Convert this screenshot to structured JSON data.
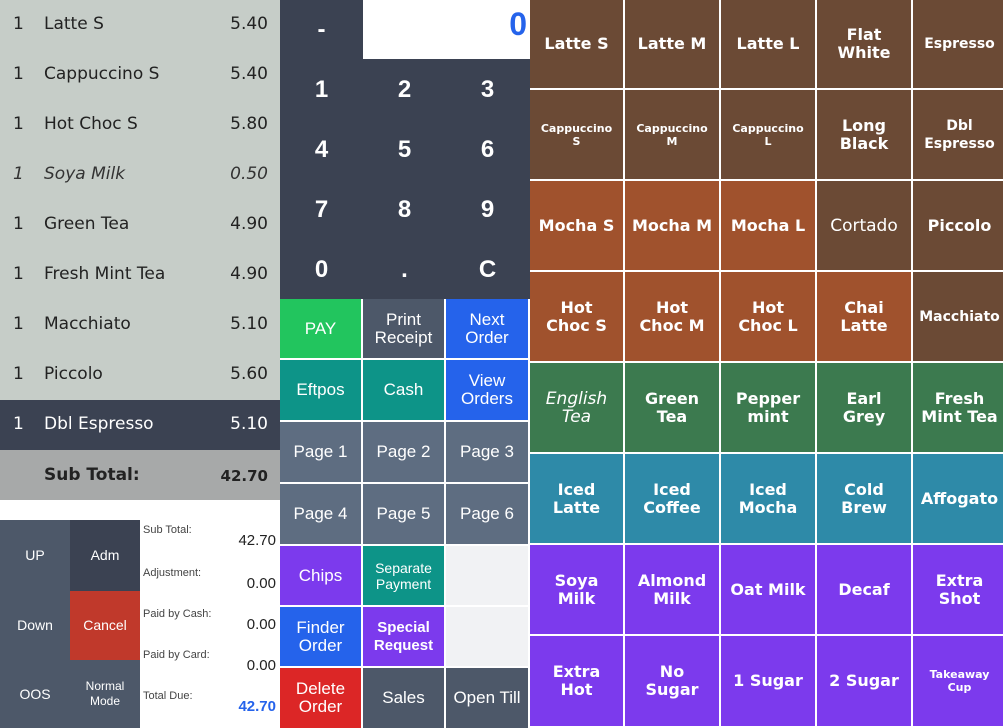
{
  "order": {
    "lines": [
      {
        "qty": "1",
        "name": "Latte S",
        "price": "5.40",
        "kind": "item"
      },
      {
        "qty": "1",
        "name": "Cappuccino S",
        "price": "5.40",
        "kind": "item"
      },
      {
        "qty": "1",
        "name": "Hot Choc S",
        "price": "5.80",
        "kind": "item"
      },
      {
        "qty": "1",
        "name": "Soya Milk",
        "price": "0.50",
        "kind": "modifier"
      },
      {
        "qty": "1",
        "name": "Green Tea",
        "price": "4.90",
        "kind": "item"
      },
      {
        "qty": "1",
        "name": "Fresh Mint Tea",
        "price": "4.90",
        "kind": "item"
      },
      {
        "qty": "1",
        "name": "Macchiato",
        "price": "5.10",
        "kind": "item"
      },
      {
        "qty": "1",
        "name": "Piccolo",
        "price": "5.60",
        "kind": "item"
      },
      {
        "qty": "1",
        "name": "Dbl Espresso",
        "price": "5.10",
        "kind": "selected"
      }
    ],
    "subtotal_label": "Sub Total:",
    "subtotal_value": "42.70"
  },
  "functions": {
    "up": "UP",
    "adm": "Adm",
    "down": "Down",
    "cancel": "Cancel",
    "oos": "OOS",
    "normal_mode": "Normal Mode"
  },
  "totals": [
    {
      "label": "Sub Total:",
      "value": "42.70"
    },
    {
      "label": "Adjustment:",
      "value": "0.00"
    },
    {
      "label": "Paid by Cash:",
      "value": "0.00"
    },
    {
      "label": "Paid by Card:",
      "value": "0.00"
    },
    {
      "label": "Total Due:",
      "value": "42.70"
    }
  ],
  "keypad": {
    "display": "0",
    "minus": "-",
    "keys": [
      "1",
      "2",
      "3",
      "4",
      "5",
      "6",
      "7",
      "8",
      "9",
      "0",
      ".",
      "C"
    ]
  },
  "actions": {
    "pay": "PAY",
    "print_receipt": "Print Receipt",
    "next_order": "Next Order",
    "eftpos": "Eftpos",
    "cash": "Cash",
    "view_orders": "View Orders",
    "page1": "Page 1",
    "page2": "Page 2",
    "page3": "Page 3",
    "page4": "Page 4",
    "page5": "Page 5",
    "page6": "Page 6",
    "chips": "Chips",
    "separate_payment": "Separate Payment",
    "finder_order": "Finder Order",
    "special_request": "Special Request",
    "delete_order": "Delete Order",
    "sales": "Sales",
    "open_till": "Open Till"
  },
  "products": [
    {
      "label": "Latte S",
      "color": "#6b4a35",
      "style": "bold"
    },
    {
      "label": "Latte M",
      "color": "#6b4a35",
      "style": "bold"
    },
    {
      "label": "Latte L",
      "color": "#6b4a35",
      "style": "bold"
    },
    {
      "label": "Flat\nWhite",
      "color": "#6b4a35",
      "style": "bold"
    },
    {
      "label": "Espresso",
      "color": "#6b4a35",
      "style": "bold-sm"
    },
    {
      "label": "Cappuccino\nS",
      "color": "#6b4a35",
      "style": "small"
    },
    {
      "label": "Cappuccino\nM",
      "color": "#6b4a35",
      "style": "small"
    },
    {
      "label": "Cappuccino\nL",
      "color": "#6b4a35",
      "style": "small"
    },
    {
      "label": "Long\nBlack",
      "color": "#6b4a35",
      "style": "bold"
    },
    {
      "label": "Dbl\nEspresso",
      "color": "#6b4a35",
      "style": "bold-sm"
    },
    {
      "label": "Mocha S",
      "color": "#a0522d",
      "style": "bold"
    },
    {
      "label": "Mocha M",
      "color": "#a0522d",
      "style": "bold"
    },
    {
      "label": "Mocha L",
      "color": "#a0522d",
      "style": "bold"
    },
    {
      "label": "Cortado",
      "color": "#6b4a35",
      "style": "plain"
    },
    {
      "label": "Piccolo",
      "color": "#6b4a35",
      "style": "bold"
    },
    {
      "label": "Hot\nChoc S",
      "color": "#a0522d",
      "style": "bold"
    },
    {
      "label": "Hot\nChoc M",
      "color": "#a0522d",
      "style": "bold"
    },
    {
      "label": "Hot\nChoc L",
      "color": "#a0522d",
      "style": "bold"
    },
    {
      "label": "Chai\nLatte",
      "color": "#a0522d",
      "style": "bold"
    },
    {
      "label": "Macchiato",
      "color": "#6b4a35",
      "style": "bold-sm"
    },
    {
      "label": "English\nTea",
      "color": "#3c7a4f",
      "style": "italic"
    },
    {
      "label": "Green\nTea",
      "color": "#3c7a4f",
      "style": "bold"
    },
    {
      "label": "Pepper\nmint",
      "color": "#3c7a4f",
      "style": "bold"
    },
    {
      "label": "Earl\nGrey",
      "color": "#3c7a4f",
      "style": "bold"
    },
    {
      "label": "Fresh\nMint Tea",
      "color": "#3c7a4f",
      "style": "bold"
    },
    {
      "label": "Iced\nLatte",
      "color": "#2e8aa8",
      "style": "bold"
    },
    {
      "label": "Iced\nCoffee",
      "color": "#2e8aa8",
      "style": "bold"
    },
    {
      "label": "Iced\nMocha",
      "color": "#2e8aa8",
      "style": "bold"
    },
    {
      "label": "Cold\nBrew",
      "color": "#2e8aa8",
      "style": "bold"
    },
    {
      "label": "Affogato",
      "color": "#2e8aa8",
      "style": "bold"
    },
    {
      "label": "Soya\nMilk",
      "color": "#7c3aed",
      "style": "bold"
    },
    {
      "label": "Almond\nMilk",
      "color": "#7c3aed",
      "style": "bold"
    },
    {
      "label": "Oat Milk",
      "color": "#7c3aed",
      "style": "bold"
    },
    {
      "label": "Decaf",
      "color": "#7c3aed",
      "style": "bold"
    },
    {
      "label": "Extra\nShot",
      "color": "#7c3aed",
      "style": "bold"
    },
    {
      "label": "Extra\nHot",
      "color": "#7c3aed",
      "style": "bold"
    },
    {
      "label": "No\nSugar",
      "color": "#7c3aed",
      "style": "bold"
    },
    {
      "label": "1 Sugar",
      "color": "#7c3aed",
      "style": "bold"
    },
    {
      "label": "2 Sugar",
      "color": "#7c3aed",
      "style": "bold"
    },
    {
      "label": "Takeaway\nCup",
      "color": "#7c3aed",
      "style": "small"
    }
  ]
}
